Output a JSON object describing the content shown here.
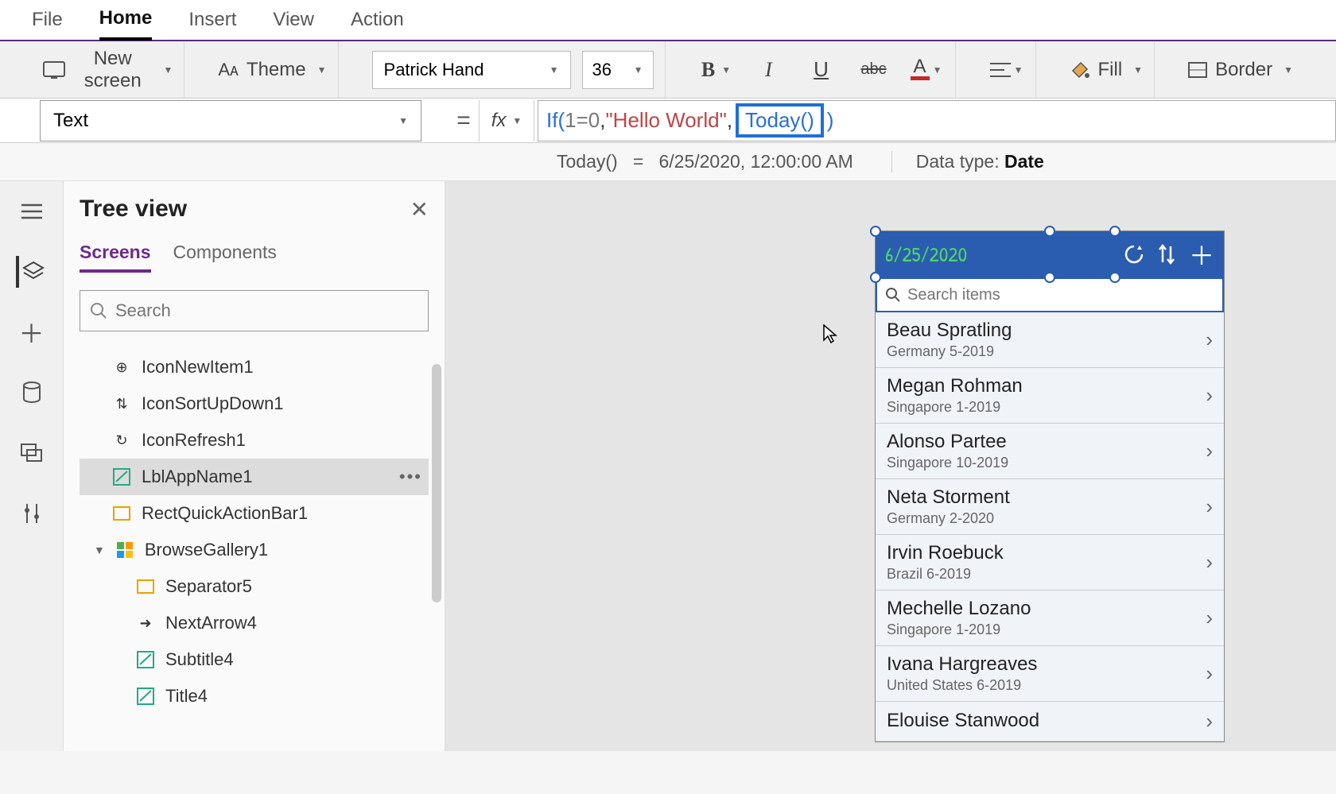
{
  "menu": {
    "file": "File",
    "home": "Home",
    "insert": "Insert",
    "view": "View",
    "action": "Action"
  },
  "ribbon": {
    "new_screen": "New screen",
    "theme": "Theme",
    "font": "Patrick Hand",
    "size": "36",
    "fill": "Fill",
    "border": "Border"
  },
  "formula": {
    "property": "Text",
    "prefix": "If(",
    "cond": "1=0",
    "sep1": ", ",
    "str": "\"Hello World\"",
    "sep2": ", ",
    "today": "Today()",
    "suffix": ")",
    "result_lhs": "Today()",
    "result_eq": "=",
    "result_rhs": "6/25/2020, 12:00:00 AM",
    "datatype_label": "Data type:",
    "datatype_value": "Date"
  },
  "treeview": {
    "title": "Tree view",
    "tab_screens": "Screens",
    "tab_components": "Components",
    "search_placeholder": "Search",
    "items": [
      {
        "label": "IconNewItem1"
      },
      {
        "label": "IconSortUpDown1"
      },
      {
        "label": "IconRefresh1"
      },
      {
        "label": "LblAppName1"
      },
      {
        "label": "RectQuickActionBar1"
      },
      {
        "label": "BrowseGallery1"
      },
      {
        "label": "Separator5"
      },
      {
        "label": "NextArrow4"
      },
      {
        "label": "Subtitle4"
      },
      {
        "label": "Title4"
      }
    ]
  },
  "preview": {
    "title": "6/25/2020",
    "search_placeholder": "Search items",
    "items": [
      {
        "name": "Beau Spratling",
        "sub": "Germany 5-2019"
      },
      {
        "name": "Megan Rohman",
        "sub": "Singapore 1-2019"
      },
      {
        "name": "Alonso Partee",
        "sub": "Singapore 10-2019"
      },
      {
        "name": "Neta Storment",
        "sub": "Germany 2-2020"
      },
      {
        "name": "Irvin Roebuck",
        "sub": "Brazil 6-2019"
      },
      {
        "name": "Mechelle Lozano",
        "sub": "Singapore 1-2019"
      },
      {
        "name": "Ivana Hargreaves",
        "sub": "United States 6-2019"
      },
      {
        "name": "Elouise Stanwood",
        "sub": ""
      }
    ]
  }
}
